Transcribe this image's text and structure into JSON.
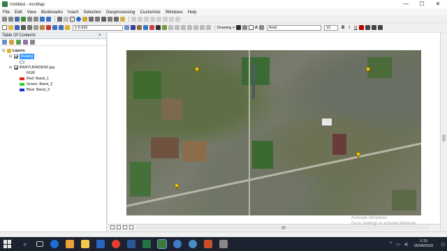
{
  "window": {
    "title": "Untitled - ArcMap",
    "minimize_glyph": "—",
    "maximize_glyph": "☐",
    "close_glyph": "✕"
  },
  "menu": [
    "File",
    "Edit",
    "View",
    "Bookmarks",
    "Insert",
    "Selection",
    "Geoprocessing",
    "Customize",
    "Windows",
    "Help"
  ],
  "toolbar": {
    "scale_value": "1:5.932",
    "drawing_label": "Drawing",
    "font_name": "Arial",
    "font_size": "10",
    "bold": "B",
    "italic": "I",
    "underline": "U",
    "text_tool": "A"
  },
  "toc": {
    "title": "Table Of Contents",
    "pin_glyph": "× ",
    "layers_label": "Layers",
    "items": [
      {
        "label": "Bulang",
        "selected": true
      },
      {
        "label": "BANYURADEN2.jpg",
        "selected": false
      }
    ],
    "rgb_label": "RGB",
    "bands": [
      {
        "label": "Red:  Band_1",
        "color": "#e8201c"
      },
      {
        "label": "Green: Band_2",
        "color": "#2fd22f"
      },
      {
        "label": "Blue:  Band_3",
        "color": "#1a2fd6"
      }
    ]
  },
  "map": {
    "markers": [
      {
        "name": "marker-1"
      },
      {
        "name": "marker-2"
      },
      {
        "name": "marker-3"
      },
      {
        "name": "marker-4"
      }
    ]
  },
  "watermark": {
    "line1": "Activate Windows",
    "line2": "Go to Settings to activate Windows."
  },
  "taskbar": {
    "time": "1:15",
    "date": "05/04/2020",
    "apps": [
      "search",
      "task-view",
      "edge",
      "store",
      "files",
      "mail",
      "chrome",
      "word",
      "excel",
      "arcmap",
      "ie",
      "arcmap-globe",
      "settings",
      "office"
    ],
    "tray_up": "^"
  }
}
